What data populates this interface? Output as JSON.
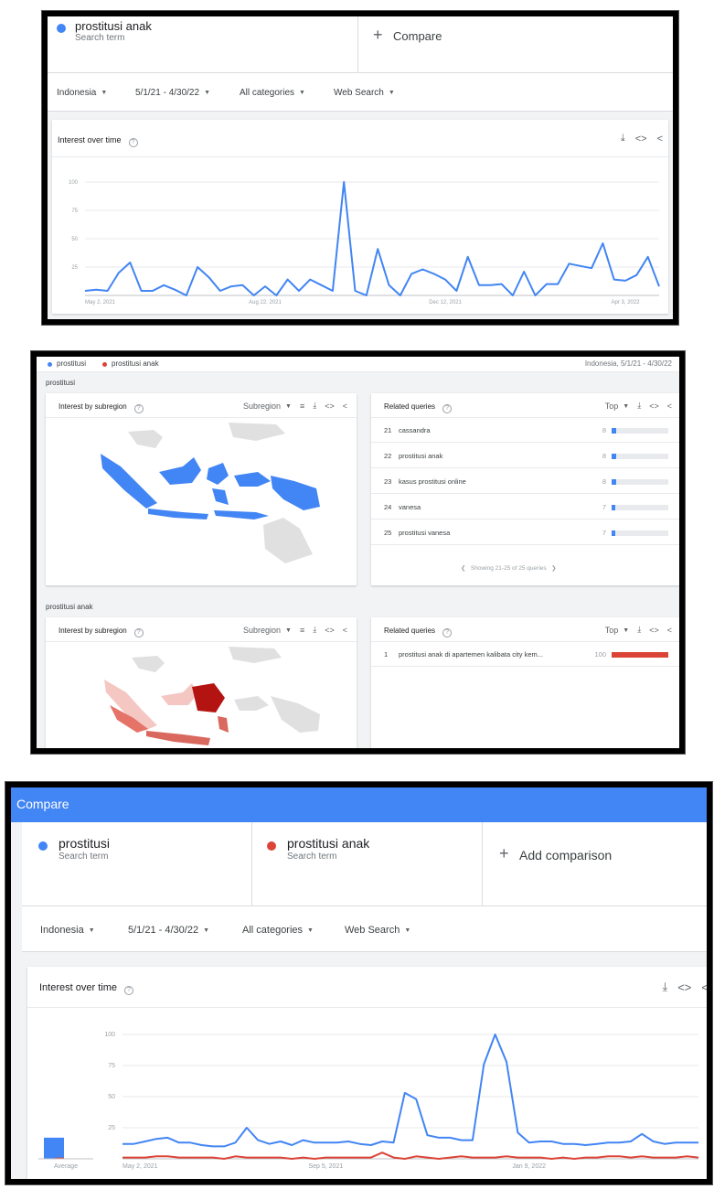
{
  "panel1": {
    "term": {
      "name": "prostitusi anak",
      "sub": "Search term",
      "color": "#4285f4"
    },
    "compare": {
      "plus": "+",
      "label": "Compare"
    },
    "filters": {
      "region": "Indonesia",
      "dates": "5/1/21 - 4/30/22",
      "category": "All categories",
      "search_type": "Web Search"
    },
    "card": {
      "title": "Interest over time",
      "help": "?"
    },
    "tools": {
      "download": "⤓",
      "embed": "<>",
      "share": "<"
    }
  },
  "panel2": {
    "legend": [
      {
        "label": "prostitusi",
        "color": "#4285f4"
      },
      {
        "label": "prostitusi anak",
        "color": "#db4437"
      }
    ],
    "region_dates": "Indonesia, 5/1/21 - 4/30/22",
    "sections": [
      {
        "title": "prostitusi",
        "subregion_card": {
          "title": "Interest by subregion",
          "selector": "Subregion"
        },
        "related_card": {
          "title": "Related queries",
          "selector": "Top",
          "rows": [
            {
              "num": "21",
              "text": "cassandra",
              "value": 8
            },
            {
              "num": "22",
              "text": "prostitusi anak",
              "value": 8
            },
            {
              "num": "23",
              "text": "kasus prostitusi online",
              "value": 8
            },
            {
              "num": "24",
              "text": "vanesa",
              "value": 7
            },
            {
              "num": "25",
              "text": "prostitusi vanesa",
              "value": 7
            }
          ],
          "pager": "Showing 21-25 of 25 queries"
        }
      },
      {
        "title": "prostitusi anak",
        "subregion_card": {
          "title": "Interest by subregion",
          "selector": "Subregion"
        },
        "related_card": {
          "title": "Related queries",
          "selector": "Top",
          "rows": [
            {
              "num": "1",
              "text": "prostitusi anak di apartemen kalibata city kem...",
              "value": 100
            }
          ]
        }
      }
    ]
  },
  "panel3": {
    "header": {
      "title": "Compare",
      "color": "#4285f4"
    },
    "terms": [
      {
        "name": "prostitusi",
        "sub": "Search term",
        "color": "#4285f4"
      },
      {
        "name": "prostitusi anak",
        "sub": "Search term",
        "color": "#db4437"
      }
    ],
    "add": {
      "plus": "+",
      "label": "Add comparison"
    },
    "filters": {
      "region": "Indonesia",
      "dates": "5/1/21 - 4/30/22",
      "category": "All categories",
      "search_type": "Web Search"
    },
    "card": {
      "title": "Interest over time",
      "help": "?"
    },
    "average_label": "Average"
  },
  "chart_data": [
    {
      "type": "line",
      "title": "Interest over time",
      "series": [
        {
          "name": "prostitusi anak",
          "color": "#4285f4",
          "values": [
            4,
            5,
            4,
            20,
            29,
            4,
            4,
            9,
            5,
            0,
            25,
            16,
            4,
            8,
            9,
            0,
            8,
            0,
            14,
            4,
            14,
            9,
            4,
            100,
            4,
            0,
            41,
            9,
            0,
            19,
            23,
            19,
            14,
            4,
            34,
            9,
            9,
            10,
            0,
            21,
            0,
            10,
            10,
            28,
            26,
            24,
            46,
            14,
            13,
            18,
            34,
            8
          ]
        }
      ],
      "y_ticks": [
        25,
        50,
        75,
        100
      ],
      "x_ticks": [
        "May 2, 2021",
        "Aug 22, 2021",
        "Dec 12, 2021",
        "Apr 3, 2022"
      ],
      "ylim": [
        0,
        100
      ],
      "grid": true
    },
    {
      "type": "line",
      "title": "Interest over time",
      "series": [
        {
          "name": "prostitusi",
          "color": "#4285f4",
          "values": [
            12,
            12,
            14,
            16,
            17,
            13,
            13,
            11,
            10,
            10,
            13,
            25,
            15,
            12,
            14,
            11,
            15,
            13,
            13,
            13,
            14,
            12,
            11,
            14,
            13,
            53,
            48,
            19,
            17,
            17,
            15,
            15,
            76,
            100,
            78,
            21,
            13,
            14,
            14,
            12,
            12,
            11,
            12,
            13,
            13,
            14,
            20,
            14,
            12,
            13,
            13,
            13
          ]
        },
        {
          "name": "prostitusi anak",
          "color": "#db4437",
          "values": [
            1,
            1,
            1,
            2,
            2,
            1,
            1,
            1,
            1,
            0,
            2,
            1,
            1,
            1,
            1,
            0,
            1,
            0,
            1,
            1,
            1,
            1,
            1,
            5,
            1,
            0,
            2,
            1,
            0,
            1,
            2,
            1,
            1,
            1,
            2,
            1,
            1,
            1,
            0,
            1,
            0,
            1,
            1,
            2,
            2,
            1,
            2,
            1,
            1,
            1,
            2,
            1
          ]
        }
      ],
      "averages": {
        "prostitusi": 17,
        "prostitusi anak": 1
      },
      "y_ticks": [
        25,
        50,
        75,
        100
      ],
      "x_ticks": [
        "May 2, 2021",
        "Sep 5, 2021",
        "Jan 9, 2022"
      ],
      "ylim": [
        0,
        100
      ],
      "grid": true
    }
  ]
}
